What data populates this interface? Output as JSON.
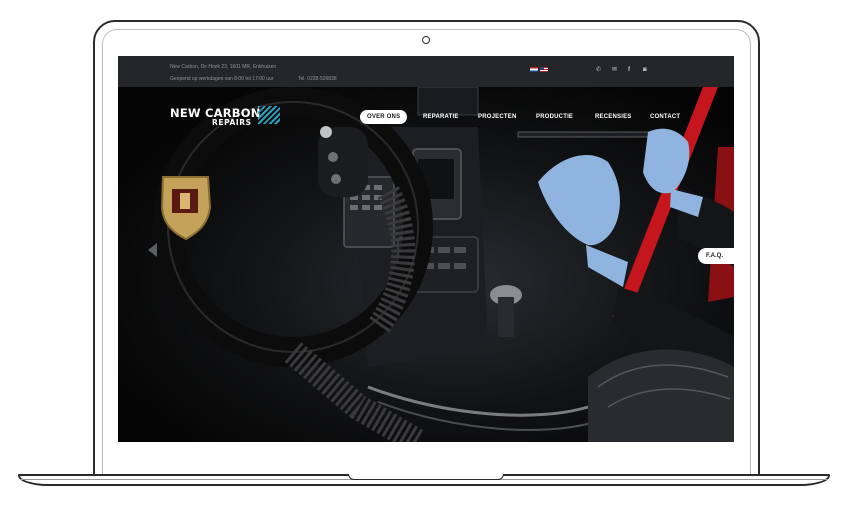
{
  "topbar": {
    "address": "New Carbon, De Hoek 23, 1601 MR, Enkhuizen",
    "hours": "Geopend op werkdagen van 8:00 tot 17:00 uur",
    "phone": "Tel. 0228-526838",
    "languages": [
      "nl-flag",
      "us-flag"
    ],
    "social_icons": [
      "phone-icon",
      "mail-icon",
      "facebook-icon",
      "instagram-icon"
    ]
  },
  "logo": {
    "line1": "NEW CARBON",
    "line2": "REPAIRS",
    "accent_color": "#2e9fbf"
  },
  "nav": {
    "items": [
      {
        "label": "OVER ONS",
        "active": true
      },
      {
        "label": "REPARATIE",
        "active": false
      },
      {
        "label": "PROJECTEN",
        "active": false
      },
      {
        "label": "PRODUCTIE",
        "active": false
      },
      {
        "label": "RECENSIES",
        "active": false
      },
      {
        "label": "CONTACT",
        "active": false
      }
    ]
  },
  "faq_label": "F.A.Q.",
  "icons": {
    "phone": "✆",
    "mail": "✉",
    "facebook": "f",
    "instagram": "◙"
  },
  "colors": {
    "topbar_bg": "#24262a",
    "glove": "#8fb4e0",
    "seatbelt": "#c4161c"
  }
}
